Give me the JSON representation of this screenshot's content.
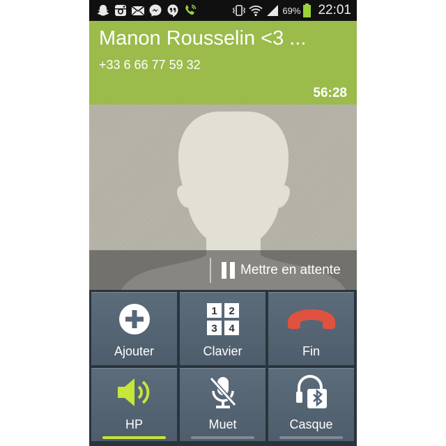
{
  "status_bar": {
    "notification_icons": [
      "snapchat-icon",
      "instagram-icon",
      "mail-icon",
      "messenger-icon",
      "hangouts-icon",
      "call-active-icon"
    ],
    "system_icons": [
      "vibrate-icon",
      "wifi-icon",
      "signal-icon"
    ],
    "battery_percent": "69%",
    "time": "22:01",
    "colors": {
      "background": "#101010",
      "battery": "#9bd13a",
      "call_icon": "#9bd13a"
    }
  },
  "call": {
    "contact_name": "Manon Rousselin <3 ...",
    "phone_number": "+33 6 66 77 59 32",
    "duration": "56:28",
    "header_color": "#9bbb4b"
  },
  "photo": {
    "hold_label": "Mettre en attente"
  },
  "controls": [
    {
      "label": "Ajouter",
      "icon": "add-call-icon"
    },
    {
      "label": "Clavier",
      "icon": "keypad-icon",
      "keys": [
        "1",
        "2",
        "3",
        "4"
      ]
    },
    {
      "label": "Fin",
      "icon": "end-call-icon",
      "icon_color": "#e0523f"
    },
    {
      "label": "HP",
      "icon": "speaker-icon",
      "active": true,
      "icon_color": "#c6e63a"
    },
    {
      "label": "Muet",
      "icon": "mute-icon",
      "active": false
    },
    {
      "label": "Casque",
      "icon": "bluetooth-headset-icon",
      "active": false
    }
  ]
}
